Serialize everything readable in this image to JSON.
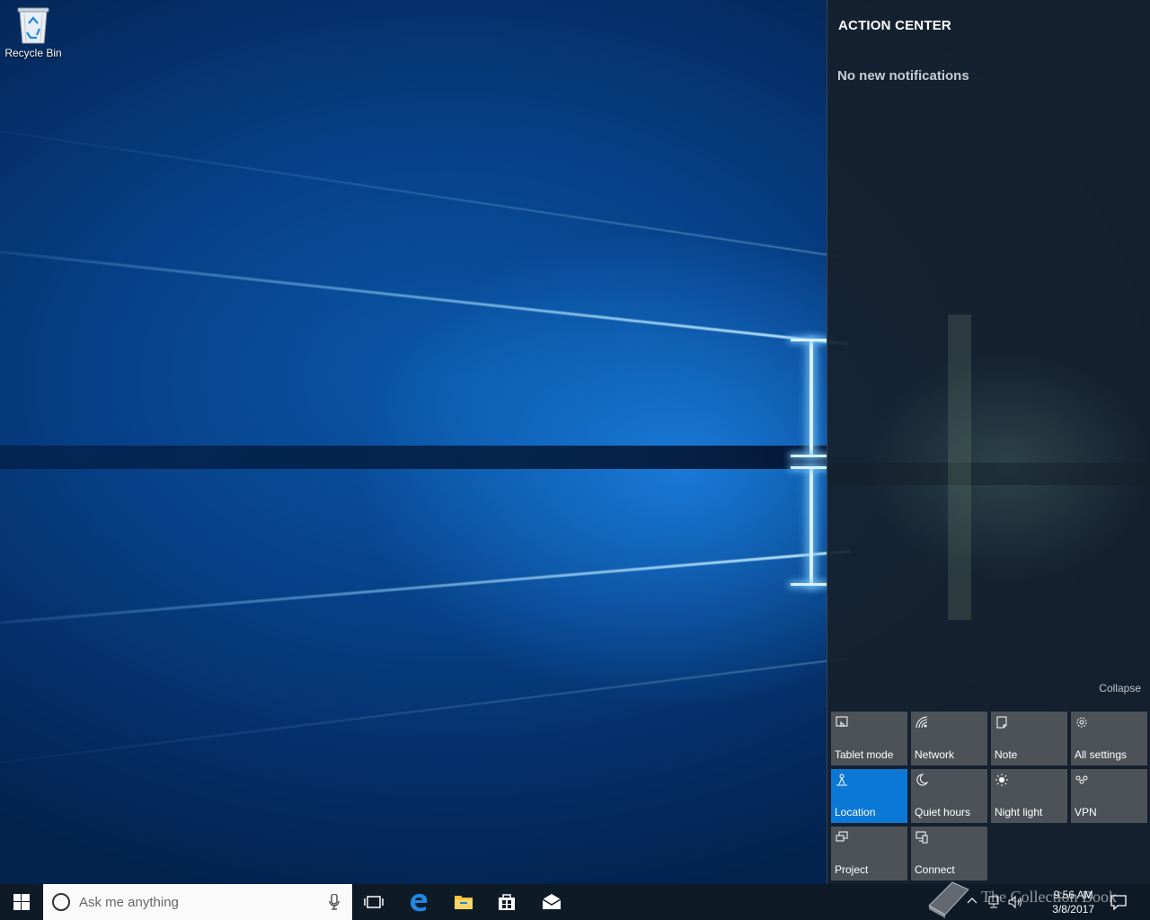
{
  "desktop": {
    "icons": [
      {
        "label": "Recycle Bin",
        "icon": "recycle-bin-icon"
      }
    ]
  },
  "action_center": {
    "title": "ACTION CENTER",
    "empty_message": "No new notifications",
    "collapse_label": "Collapse",
    "tiles": [
      {
        "label": "Tablet mode",
        "icon": "tablet-mode-icon",
        "active": false
      },
      {
        "label": "Network",
        "icon": "network-icon",
        "active": false
      },
      {
        "label": "Note",
        "icon": "note-icon",
        "active": false
      },
      {
        "label": "All settings",
        "icon": "gear-icon",
        "active": false
      },
      {
        "label": "Location",
        "icon": "location-icon",
        "active": true
      },
      {
        "label": "Quiet hours",
        "icon": "moon-icon",
        "active": false
      },
      {
        "label": "Night light",
        "icon": "brightness-icon",
        "active": false
      },
      {
        "label": "VPN",
        "icon": "vpn-icon",
        "active": false
      },
      {
        "label": "Project",
        "icon": "project-icon",
        "active": false
      },
      {
        "label": "Connect",
        "icon": "connect-icon",
        "active": false
      }
    ],
    "colors": {
      "active_tile": "#0b78d6",
      "tile": "#4d5258"
    }
  },
  "taskbar": {
    "search_placeholder": "Ask me anything",
    "pinned": [
      "task-view-icon",
      "edge-icon",
      "file-explorer-icon",
      "store-icon",
      "mail-icon"
    ],
    "clock": {
      "time": "9:56 AM",
      "date": "3/8/2017"
    }
  },
  "watermark": {
    "text": "The Collection Book"
  }
}
